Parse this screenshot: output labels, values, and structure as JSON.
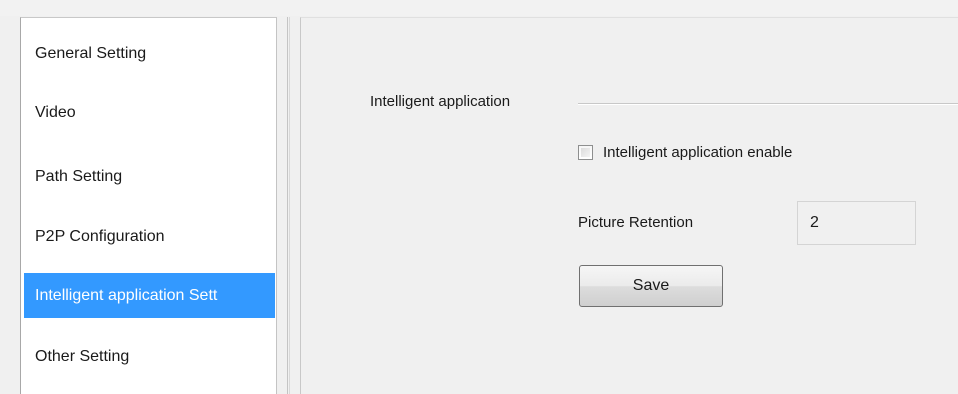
{
  "sidebar": {
    "items": [
      {
        "label": "General Setting",
        "selected": false
      },
      {
        "label": "Video",
        "selected": false
      },
      {
        "label": "Path Setting",
        "selected": false
      },
      {
        "label": "P2P Configuration",
        "selected": false
      },
      {
        "label": "Intelligent application Sett",
        "selected": true
      },
      {
        "label": "Other Setting",
        "selected": false
      }
    ]
  },
  "main": {
    "group_title": "Intelligent application",
    "enable_checkbox": {
      "label": "Intelligent application enable",
      "checked": false
    },
    "picture_retention": {
      "label": "Picture Retention",
      "value": "2"
    },
    "save_label": "Save"
  },
  "colors": {
    "selection": "#3399ff",
    "panel_background": "#f0f0f0",
    "sidebar_background": "#ffffff"
  }
}
